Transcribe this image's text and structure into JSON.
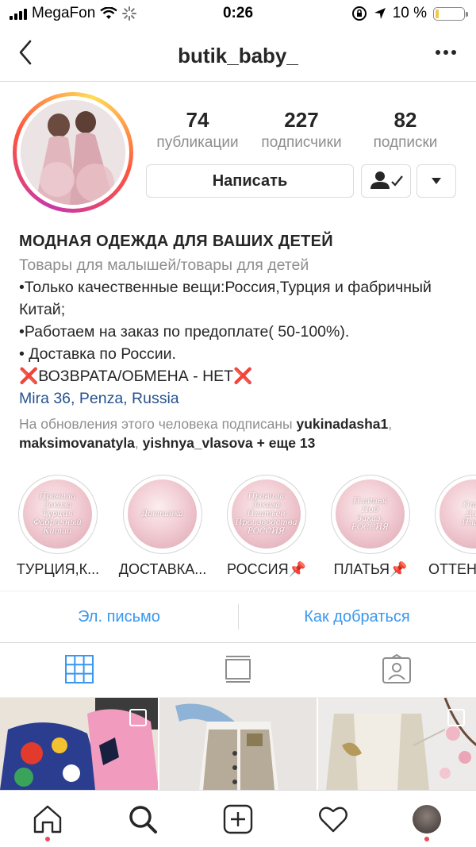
{
  "status_bar": {
    "carrier": "MegaFon",
    "time": "0:26",
    "battery": "10 %",
    "battery_level": 0.1
  },
  "header": {
    "username": "butik_baby_"
  },
  "profile": {
    "stats": [
      {
        "value": "74",
        "label": "публикации"
      },
      {
        "value": "227",
        "label": "подписчики"
      },
      {
        "value": "82",
        "label": "подписки"
      }
    ],
    "message_button": "Написать",
    "name": "МОДНАЯ ОДЕЖДА ДЛЯ ВАШИХ ДЕТЕЙ",
    "category": "Товары для малышей/товары для детей",
    "bio_lines": [
      "•Только качественные вещи:Россия,Турция и фабричный Китай;",
      "•Работаем на заказ по предоплате( 50-100%).",
      "• Доставка по России.",
      "ВОЗВРАТА/ОБМЕНА - НЕТ"
    ],
    "location": {
      "city1": "Mira 36",
      "city2": "Penza",
      "city3": "Russia"
    },
    "followed_by": {
      "prefix": "На обновления этого человека подписаны",
      "user1": "yukinadasha1",
      "user2": "maksimovanatyla",
      "user3": "yishnya_vlasova",
      "more": "+ еще 13"
    }
  },
  "highlights": [
    {
      "label": "ТУРЦИЯ,К...",
      "cover": "Правила\nЗаказа\nТурция\nФабричный Китай"
    },
    {
      "label": "ДОСТАВКА...",
      "cover": "Доставка"
    },
    {
      "label": "РОССИЯ📌",
      "cover": "Правила\nЗаказа\nПлатьев\nПроизводства\nРОССИЯ"
    },
    {
      "label": "ПЛАТЬЯ📌",
      "cover": "Платья\nПод\nЗаказ.\nРОССИЯ"
    },
    {
      "label": "ОТТЕН...",
      "cover": "Отт\nДля\nПлат"
    }
  ],
  "contact": {
    "email": "Эл. письмо",
    "directions": "Как добраться"
  },
  "colors": {
    "link": "#3897f0",
    "location": "#26538f",
    "notification": "#ed4956"
  }
}
